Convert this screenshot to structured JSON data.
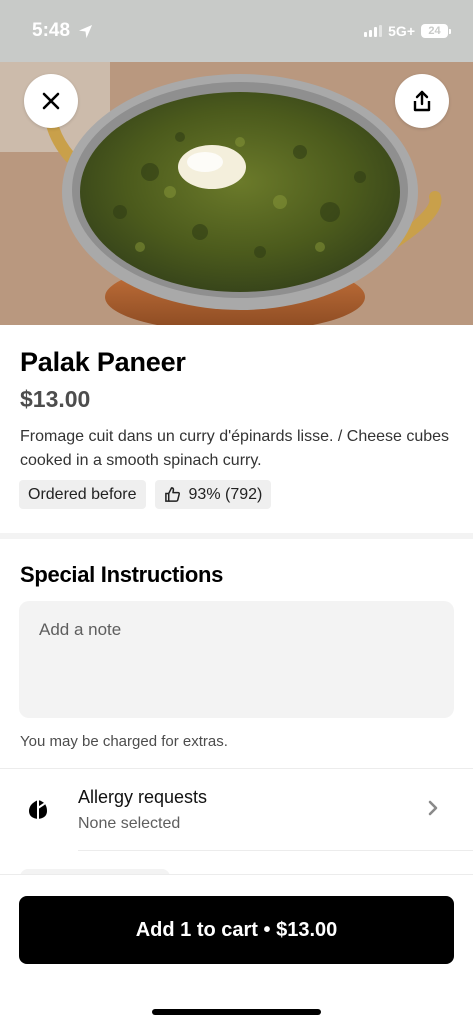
{
  "status": {
    "time": "5:48",
    "network": "5G+",
    "battery": "24"
  },
  "hero": {
    "alt_subject": "spinach curry in copper bowl",
    "close_icon": "close-icon",
    "share_icon": "share-icon"
  },
  "item": {
    "name": "Palak Paneer",
    "price": "$13.00",
    "description": "Fromage cuit dans un curry d'épinards lisse. / Cheese cubes cooked in a smooth spinach curry.",
    "badges": {
      "ordered_before": "Ordered before",
      "rating": "93% (792)"
    }
  },
  "instructions": {
    "title": "Special Instructions",
    "placeholder": "Add a note",
    "extras_note": "You may be charged for extras."
  },
  "allergy": {
    "title": "Allergy requests",
    "value": "None selected"
  },
  "cart": {
    "label": "Add 1 to cart • $13.00"
  },
  "colors": {
    "primary_button": "#000000",
    "chip_bg": "#efefef",
    "input_bg": "#f3f3f3"
  }
}
